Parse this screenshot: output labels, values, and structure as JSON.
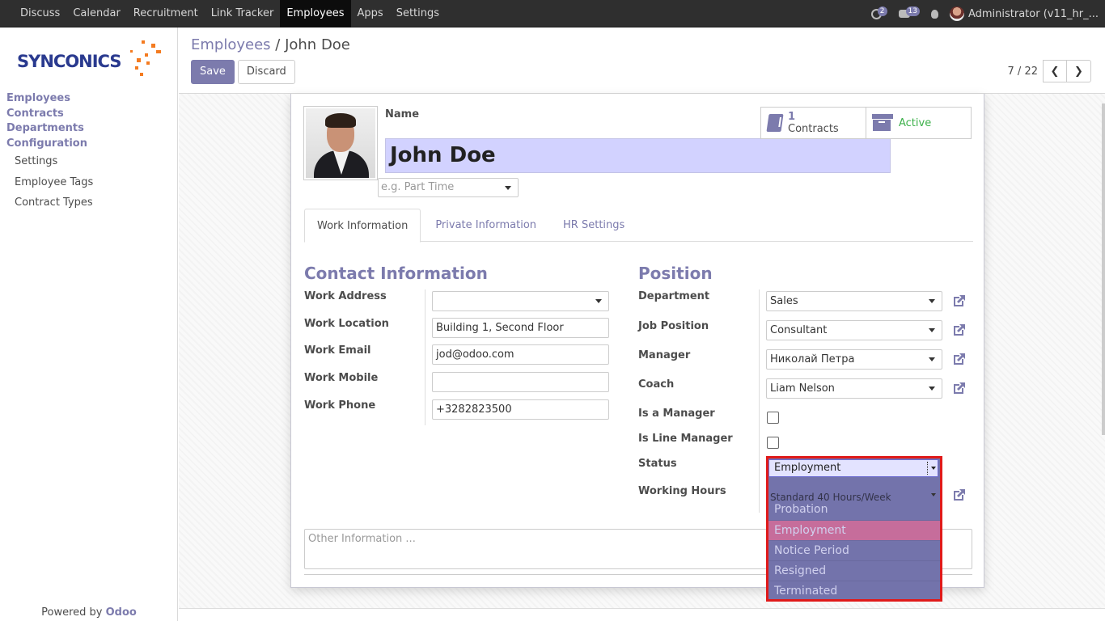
{
  "topbar": {
    "menu": [
      "Discuss",
      "Calendar",
      "Recruitment",
      "Link Tracker",
      "Employees",
      "Apps",
      "Settings"
    ],
    "active_menu": "Employees",
    "activity_count": "2",
    "message_count": "13",
    "user": "Administrator (v11_hr_..."
  },
  "sidebar": {
    "logo_text": "SYNCONICS",
    "main_items": [
      "Employees",
      "Contracts",
      "Departments",
      "Configuration"
    ],
    "sub_items": [
      "Settings",
      "Employee Tags",
      "Contract Types"
    ],
    "powered_prefix": "Powered by",
    "powered_brand": "Odoo"
  },
  "control_panel": {
    "breadcrumb_parent": "Employees",
    "breadcrumb_sep": "/",
    "breadcrumb_current": "John Doe",
    "save_label": "Save",
    "discard_label": "Discard",
    "pager": "7 / 22"
  },
  "form": {
    "name_label": "Name",
    "name_value": "John Doe",
    "tags_placeholder": "e.g. Part Time",
    "smart_buttons": {
      "contracts_count": "1",
      "contracts_label": "Contracts",
      "active_label": "Active"
    },
    "tabs": [
      "Work Information",
      "Private Information",
      "HR Settings"
    ],
    "contact_title": "Contact Information",
    "contact_fields": {
      "work_address_label": "Work Address",
      "work_address_value": "",
      "work_location_label": "Work Location",
      "work_location_value": "Building 1, Second Floor",
      "work_email_label": "Work Email",
      "work_email_value": "jod@odoo.com",
      "work_mobile_label": "Work Mobile",
      "work_mobile_value": "",
      "work_phone_label": "Work Phone",
      "work_phone_value": "+3282823500"
    },
    "position_title": "Position",
    "position_fields": {
      "department_label": "Department",
      "department_value": "Sales",
      "job_label": "Job Position",
      "job_value": "Consultant",
      "manager_label": "Manager",
      "manager_value": "Николай Петра",
      "coach_label": "Coach",
      "coach_value": "Liam Nelson",
      "is_manager_label": "Is a Manager",
      "is_line_manager_label": "Is Line Manager",
      "status_label": "Status",
      "status_value": "Employment",
      "working_hours_label": "Working Hours",
      "working_hours_value": "Standard 40 Hours/Week"
    },
    "other_info_placeholder": "Other Information ..."
  },
  "status_dropdown": {
    "options": [
      "Probation",
      "Employment",
      "Notice Period",
      "Resigned",
      "Terminated"
    ],
    "selected": "Employment"
  },
  "colors": {
    "brand": "#7c7bad",
    "active_green": "#3cb04a",
    "highlight_red": "#e01a1a",
    "dropdown_bg": "#7373ab",
    "dropdown_selected": "#c66d9b"
  }
}
